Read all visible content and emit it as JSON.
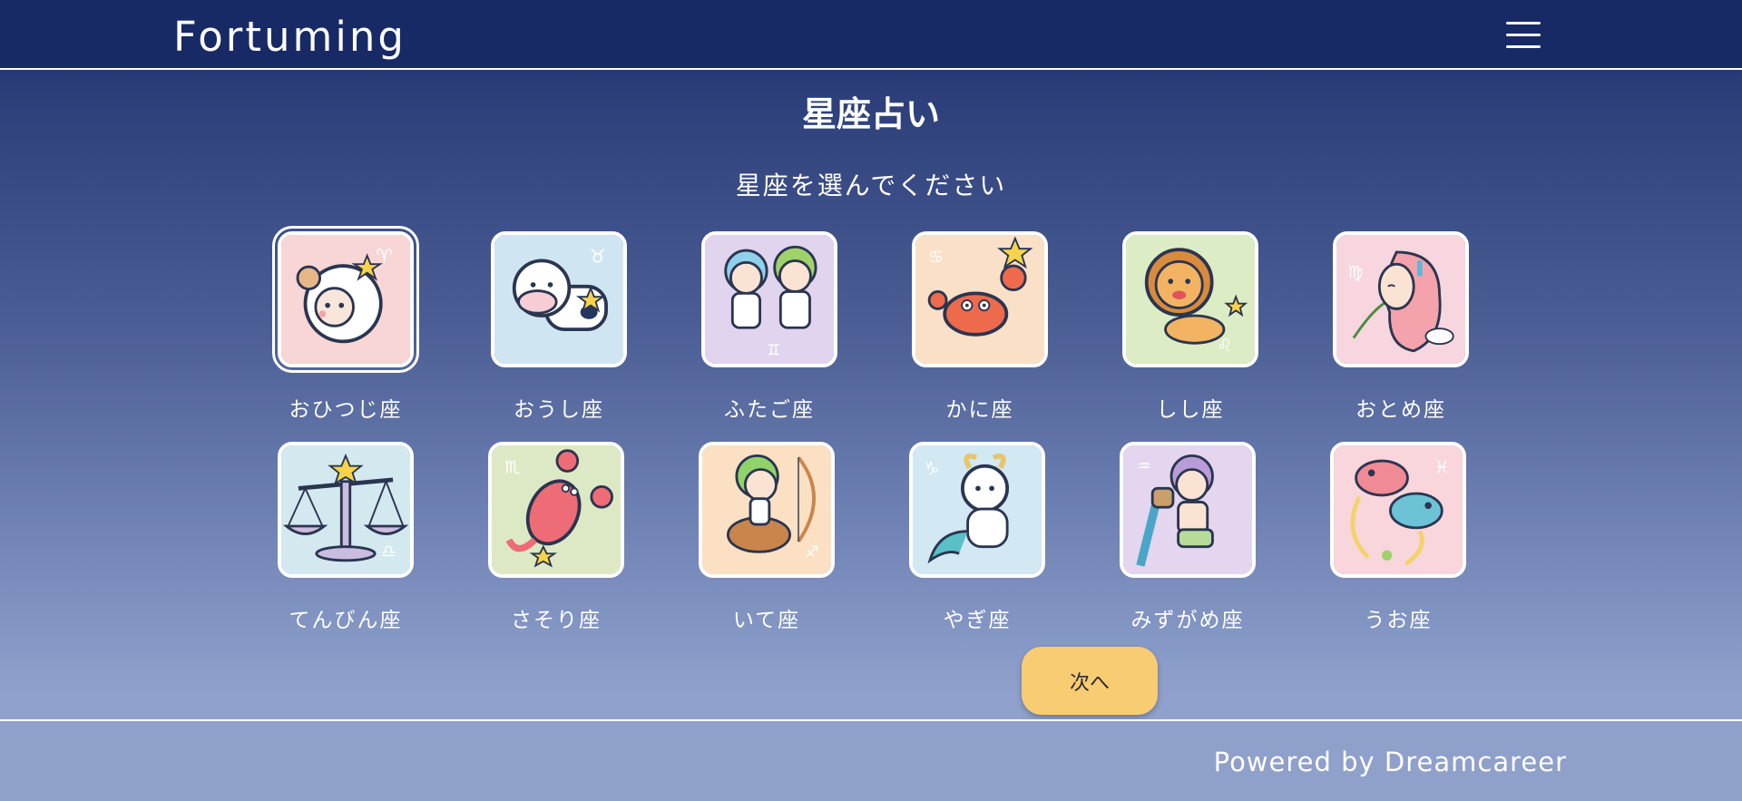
{
  "header": {
    "brand": "Fortuming",
    "menu_icon": "hamburger-menu-icon"
  },
  "page": {
    "title": "星座占い",
    "subtitle": "星座を選んでください"
  },
  "signs": [
    {
      "label": "おひつじ座",
      "icon": "ram-icon",
      "bg": "#f8d6d6",
      "symbol": "♈",
      "selected": true
    },
    {
      "label": "おうし座",
      "icon": "bull-icon",
      "bg": "#cfe6f2",
      "symbol": "♉",
      "selected": false
    },
    {
      "label": "ふたご座",
      "icon": "twins-icon",
      "bg": "#e0d4ee",
      "symbol": "♊",
      "selected": false
    },
    {
      "label": "かに座",
      "icon": "crab-icon",
      "bg": "#fbe0c8",
      "symbol": "♋",
      "selected": false
    },
    {
      "label": "しし座",
      "icon": "lion-icon",
      "bg": "#dcecc4",
      "symbol": "♌",
      "selected": false
    },
    {
      "label": "おとめ座",
      "icon": "maiden-icon",
      "bg": "#f7d6df",
      "symbol": "♍",
      "selected": false
    },
    {
      "label": "てんびん座",
      "icon": "scales-icon",
      "bg": "#d4e8f0",
      "symbol": "♎",
      "selected": false
    },
    {
      "label": "さそり座",
      "icon": "scorpion-icon",
      "bg": "#dde9c4",
      "symbol": "♏",
      "selected": false
    },
    {
      "label": "いて座",
      "icon": "archer-icon",
      "bg": "#fbe0c4",
      "symbol": "♐",
      "selected": false
    },
    {
      "label": "やぎ座",
      "icon": "goat-icon",
      "bg": "#d2e8f2",
      "symbol": "♑",
      "selected": false
    },
    {
      "label": "みずがめ座",
      "icon": "water-bearer-icon",
      "bg": "#e4d6ee",
      "symbol": "♒",
      "selected": false
    },
    {
      "label": "うお座",
      "icon": "fish-icon",
      "bg": "#f8d6dc",
      "symbol": "♓",
      "selected": false
    }
  ],
  "actions": {
    "next_label": "次へ"
  },
  "footer": {
    "powered": "Powered by Dreamcareer"
  },
  "colors": {
    "header_bg": "#172a66",
    "button_bg": "#f8cc73",
    "footer_bg": "#8fa0cb"
  }
}
